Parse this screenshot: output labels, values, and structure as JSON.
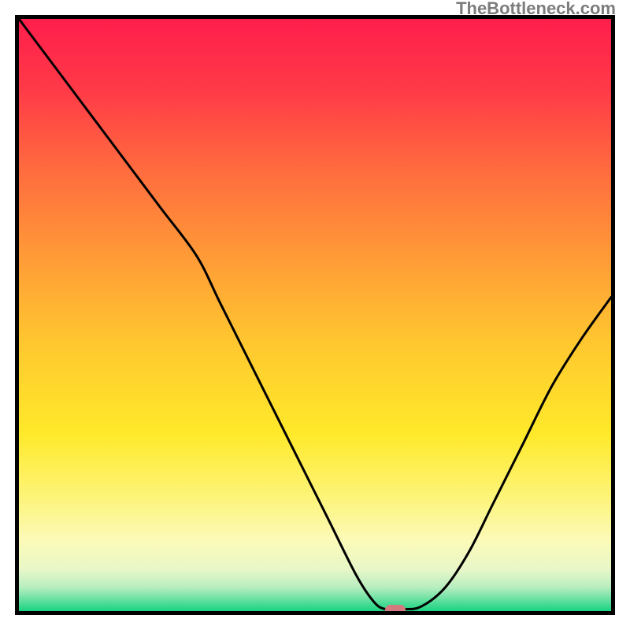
{
  "watermark": "TheBottleneck.com",
  "chart_data": {
    "type": "line",
    "title": "",
    "xlabel": "",
    "ylabel": "",
    "xlim": [
      0,
      100
    ],
    "ylim": [
      0,
      100
    ],
    "grid": false,
    "legend": false,
    "annotations": [],
    "background": {
      "type": "vertical_gradient",
      "stops": [
        {
          "pos": 0.0,
          "color": "#ff1e4c"
        },
        {
          "pos": 0.12,
          "color": "#ff3a47"
        },
        {
          "pos": 0.25,
          "color": "#ff6a3f"
        },
        {
          "pos": 0.4,
          "color": "#ff9a37"
        },
        {
          "pos": 0.55,
          "color": "#ffc82f"
        },
        {
          "pos": 0.7,
          "color": "#ffe92a"
        },
        {
          "pos": 0.8,
          "color": "#fdf373"
        },
        {
          "pos": 0.88,
          "color": "#fcfab8"
        },
        {
          "pos": 0.93,
          "color": "#e8f7c8"
        },
        {
          "pos": 0.96,
          "color": "#b7eec0"
        },
        {
          "pos": 0.985,
          "color": "#55dd9a"
        },
        {
          "pos": 1.0,
          "color": "#18d37f"
        }
      ]
    },
    "series": [
      {
        "name": "bottleneck-curve",
        "x": [
          0.0,
          6.0,
          12.0,
          18.0,
          24.0,
          30.0,
          34.0,
          40.0,
          46.0,
          52.0,
          57.0,
          60.0,
          62.0,
          65.0,
          68.0,
          72.0,
          76.0,
          80.0,
          85.0,
          90.0,
          95.0,
          100.0
        ],
        "y": [
          100.0,
          92.0,
          84.0,
          76.0,
          68.0,
          60.0,
          52.0,
          40.0,
          28.0,
          16.0,
          6.0,
          1.5,
          0.3,
          0.3,
          0.8,
          4.0,
          10.0,
          18.0,
          28.0,
          38.0,
          46.0,
          53.0
        ]
      }
    ],
    "marker": {
      "name": "optimal-point",
      "x": 63.5,
      "y": 0.3,
      "color": "#d47a7e",
      "shape": "pill"
    }
  }
}
